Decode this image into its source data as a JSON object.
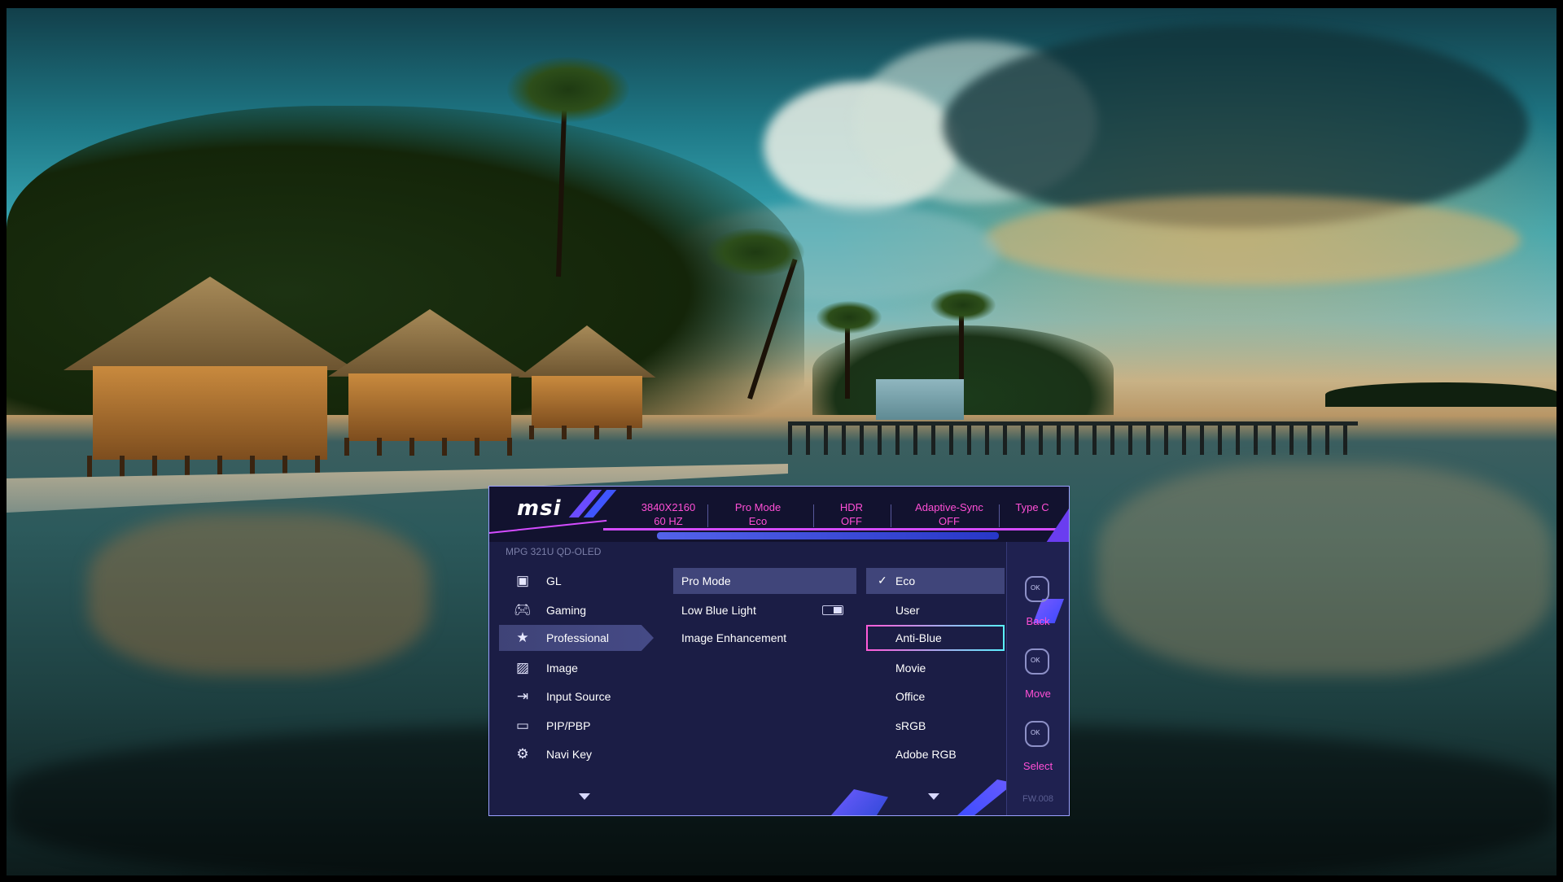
{
  "osd": {
    "brand": "msi",
    "status": [
      {
        "line1": "3840X2160",
        "line2": "60 HZ"
      },
      {
        "line1": "Pro Mode",
        "line2": "Eco"
      },
      {
        "line1": "HDR",
        "line2": "OFF"
      },
      {
        "line1": "Adaptive-Sync",
        "line2": "OFF"
      },
      {
        "line1": "Type C",
        "line2": ""
      }
    ],
    "model": "MPG 321U QD-OLED",
    "menu": [
      {
        "label": "GL",
        "icon": "game-lobby-icon",
        "active": false
      },
      {
        "label": "Gaming",
        "icon": "gamepad-icon",
        "active": false
      },
      {
        "label": "Professional",
        "icon": "star-icon",
        "active": true
      },
      {
        "label": "Image",
        "icon": "image-icon",
        "active": false
      },
      {
        "label": "Input Source",
        "icon": "input-source-icon",
        "active": false
      },
      {
        "label": "PIP/PBP",
        "icon": "pip-icon",
        "active": false
      },
      {
        "label": "Navi Key",
        "icon": "navi-key-icon",
        "active": false
      }
    ],
    "submenu": [
      {
        "label": "Pro Mode",
        "active": true
      },
      {
        "label": "Low Blue Light",
        "active": false,
        "toggle": "on"
      },
      {
        "label": "Image Enhancement",
        "active": false
      }
    ],
    "options": [
      {
        "label": "Eco",
        "checked": true,
        "state": "selected"
      },
      {
        "label": "User",
        "checked": false,
        "state": ""
      },
      {
        "label": "Anti-Blue",
        "checked": false,
        "state": "focused"
      },
      {
        "label": "Movie",
        "checked": false,
        "state": ""
      },
      {
        "label": "Office",
        "checked": false,
        "state": ""
      },
      {
        "label": "sRGB",
        "checked": false,
        "state": ""
      },
      {
        "label": "Adobe RGB",
        "checked": false,
        "state": ""
      }
    ],
    "nav": [
      {
        "label": "Back",
        "icon": "joystick-back-icon",
        "glyph": "OK"
      },
      {
        "label": "Move",
        "icon": "joystick-move-icon",
        "glyph": "OK"
      },
      {
        "label": "Select",
        "icon": "joystick-select-icon",
        "glyph": "OK"
      }
    ],
    "firmware": "FW.008",
    "colors": {
      "panel": "#1b1d45",
      "accent": "#ff4fd6",
      "highlight": "#40457a",
      "header": "#12122f"
    }
  }
}
